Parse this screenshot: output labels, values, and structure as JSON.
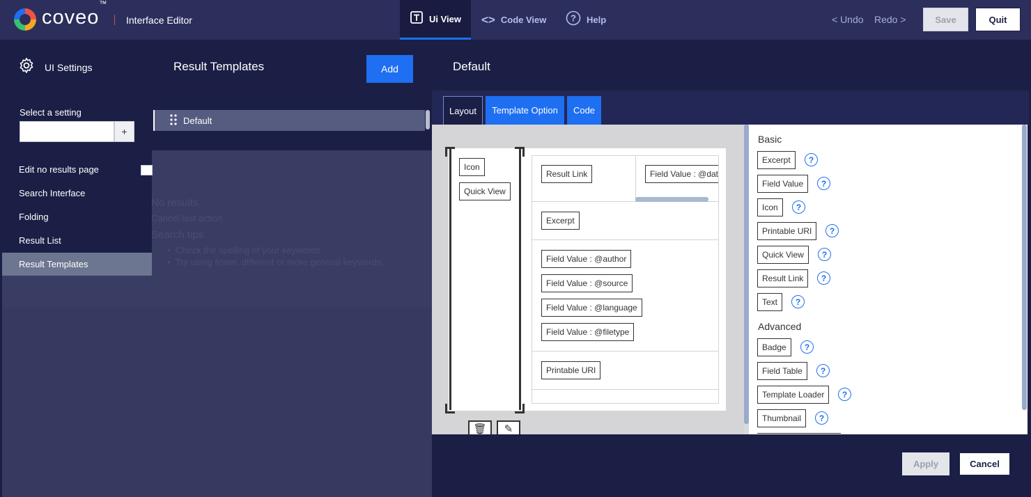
{
  "header": {
    "brand": "coveo",
    "brand_tm": "™",
    "app_title": "Interface Editor",
    "tabs": [
      {
        "label": "Ui View",
        "icon": "document-view-icon",
        "active": true
      },
      {
        "label": "Code View",
        "icon": "code-brackets-icon",
        "active": false
      },
      {
        "label": "Help",
        "icon": "help-circle-icon",
        "active": false
      }
    ],
    "undo": "< Undo",
    "redo": "Redo >",
    "save": "Save",
    "quit": "Quit"
  },
  "sidebar": {
    "title": "UI Settings",
    "select_label": "Select a setting",
    "select_value": "",
    "select_add": "+",
    "items": [
      {
        "label": "Edit no results page"
      },
      {
        "label": "Search Interface"
      },
      {
        "label": "Folding"
      },
      {
        "label": "Result List"
      },
      {
        "label": "Result Templates",
        "active": true
      }
    ],
    "edit_no_results_checked": false
  },
  "templates_panel": {
    "title": "Result Templates",
    "add": "Add",
    "items": [
      {
        "label": "Default",
        "selected": true
      }
    ],
    "ghost": {
      "no_results": "No results",
      "cancel": "Cancel last action",
      "tips_title": "Search tips",
      "tips": [
        "Check the spelling of your keywords.",
        "Try using fewer, different or more general keywords."
      ]
    }
  },
  "editor": {
    "title": "Default",
    "tabs": [
      "Layout",
      "Template Option",
      "Code"
    ],
    "active_tab": "Layout",
    "left_column": [
      "Icon",
      "Quick View"
    ],
    "rows": {
      "row1": [
        "Result Link",
        "Field Value : @dat"
      ],
      "row2": [
        "Excerpt"
      ],
      "row3": [
        "Field Value : @author",
        "Field Value : @source",
        "Field Value : @language",
        "Field Value : @filetype"
      ],
      "row4": [
        "Printable URI"
      ]
    },
    "tools": {
      "delete": "🗑",
      "edit": "✎"
    }
  },
  "components": {
    "basic_title": "Basic",
    "basic": [
      "Excerpt",
      "Field Value",
      "Icon",
      "Printable URI",
      "Quick View",
      "Result Link",
      "Text"
    ],
    "advanced_title": "Advanced",
    "advanced": [
      "Badge",
      "Field Table",
      "Template Loader",
      "Thumbnail"
    ],
    "help_glyph": "?"
  },
  "footer": {
    "apply": "Apply",
    "cancel": "Cancel"
  },
  "colors": {
    "navy": "#1b1f45",
    "accent": "#1e6ff1",
    "header": "#2c2f5c"
  }
}
